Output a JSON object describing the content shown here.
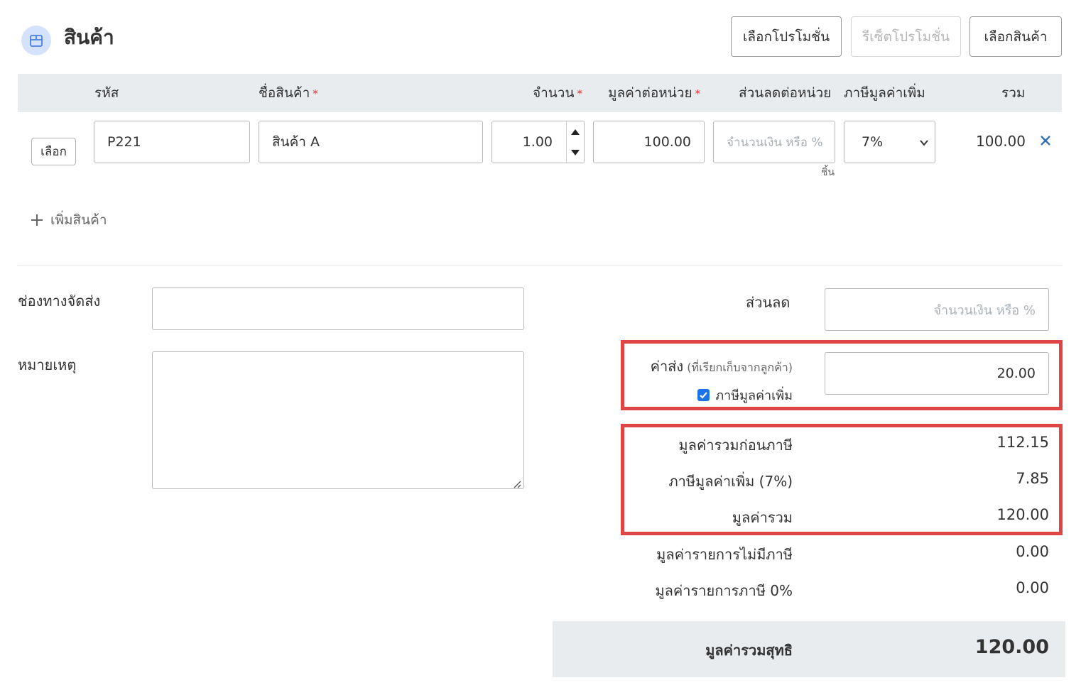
{
  "header": {
    "title": "สินค้า",
    "buttons": {
      "select_promotion": "เลือกโปรโมชั่น",
      "reset_promotion": "รีเซ็ตโปรโมชั่น",
      "select_product": "เลือกสินค้า"
    }
  },
  "table": {
    "columns": {
      "code": "รหัส",
      "name": "ชื่อสินค้า",
      "quantity": "จำนวน",
      "unit_price": "มูลค่าต่อหน่วย",
      "discount": "ส่วนลดต่อหน่วย",
      "vat": "ภาษีมูลค่าเพิ่ม",
      "total": "รวม"
    },
    "required_mark": "*",
    "row": {
      "select_label": "เลือก",
      "code": "P221",
      "name": "สินค้า A",
      "quantity": "1.00",
      "unit_price": "100.00",
      "discount_placeholder": "จำนวนเงิน หรือ %",
      "unit": "ชิ้น",
      "vat": "7%",
      "total": "100.00"
    },
    "add_item": "เพิ่มสินค้า"
  },
  "form": {
    "shipping_channel_label": "ช่องทางจัดส่ง",
    "shipping_channel_value": "",
    "note_label": "หมายเหตุ",
    "note_value": ""
  },
  "summary": {
    "discount_label": "ส่วนลด",
    "discount_placeholder": "จำนวนเงิน หรือ %",
    "shipping_label": "ค่าส่ง",
    "shipping_hint": "(ที่เรียกเก็บจากลูกค้า)",
    "shipping_vat_label": "ภาษีมูลค่าเพิ่ม",
    "shipping_vat_checked": true,
    "shipping_value": "20.00",
    "rows": [
      {
        "label": "มูลค่ารวมก่อนภาษี",
        "value": "112.15"
      },
      {
        "label": "ภาษีมูลค่าเพิ่ม (7%)",
        "value": "7.85"
      },
      {
        "label": "มูลค่ารวม",
        "value": "120.00"
      },
      {
        "label": "มูลค่ารายการไม่มีภาษี",
        "value": "0.00"
      },
      {
        "label": "มูลค่ารายการภาษี 0%",
        "value": "0.00"
      }
    ],
    "net_label": "มูลค่ารวมสุทธิ",
    "net_value": "120.00"
  },
  "colors": {
    "highlight": "#e04545",
    "header_bg": "#e9ecef",
    "icon_bg": "#d5e2fb",
    "icon_stroke": "#4a7fe0",
    "checkbox": "#1a73e8",
    "remove_icon": "#2f6fb3"
  },
  "icons": {
    "section": "box-icon",
    "add": "plus-icon",
    "remove": "close-icon",
    "select": "chevron-down-icon"
  }
}
